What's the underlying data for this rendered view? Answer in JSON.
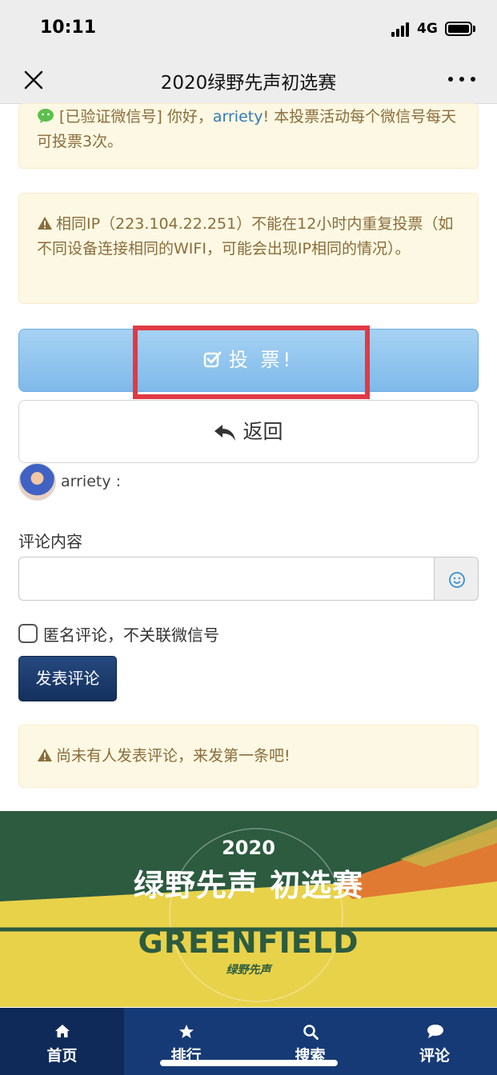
{
  "status_bar": {
    "time": "10:11",
    "network": "4G"
  },
  "nav": {
    "title": "2020绿野先声初选赛"
  },
  "alerts": {
    "verified": {
      "prefix": "[已验证微信号] 你好，",
      "user": "arriety",
      "suffix": "! 本投票活动每个微信号每天可投票3次。"
    },
    "ip_warning": {
      "text": "相同IP（223.104.22.251）不能在12小时内重复投票（如不同设备连接相同的WIFI，可能会出现IP相同的情况）。"
    },
    "no_comment": {
      "text": "尚未有人发表评论，来发第一条吧!"
    }
  },
  "buttons": {
    "vote": "投 票!",
    "back": "返回",
    "post": "发表评论"
  },
  "user": {
    "name": "arriety :"
  },
  "comment": {
    "label": "评论内容",
    "value": "",
    "anonymous_label": "匿名评论，不关联微信号"
  },
  "banner": {
    "year": "2020",
    "title": "绿野先声 初选赛",
    "brand": "GREENFIELD",
    "stamp": "绿野先声"
  },
  "tabs": [
    {
      "label": "首页",
      "icon": "home-icon"
    },
    {
      "label": "排行",
      "icon": "star-icon"
    },
    {
      "label": "搜索",
      "icon": "search-icon"
    },
    {
      "label": "评论",
      "icon": "comment-icon"
    }
  ],
  "colors": {
    "vote_button": "#8cc3ee",
    "highlight_border": "#e03a44",
    "post_button": "#1b3a6b",
    "tab_bar": "#163a75",
    "alert_bg": "#fcf8e3",
    "banner_green": "#2e5d3f",
    "banner_yellow": "#e8d24a"
  }
}
